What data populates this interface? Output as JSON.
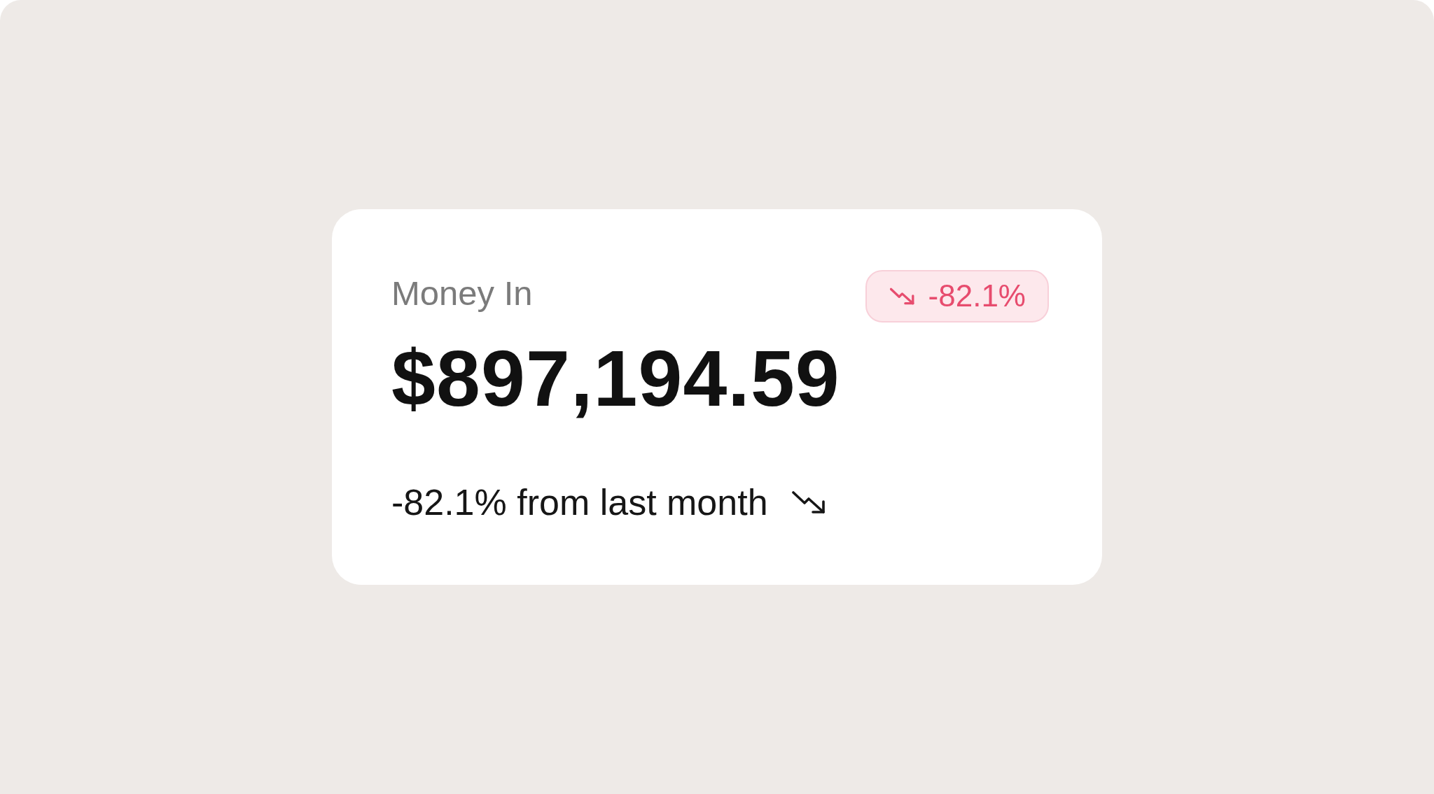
{
  "card": {
    "title": "Money In",
    "amount": "$897,194.59",
    "change_badge": {
      "text": "-82.1%",
      "negative": true
    },
    "footer": {
      "text": "-82.1% from last month",
      "negative": true
    }
  }
}
